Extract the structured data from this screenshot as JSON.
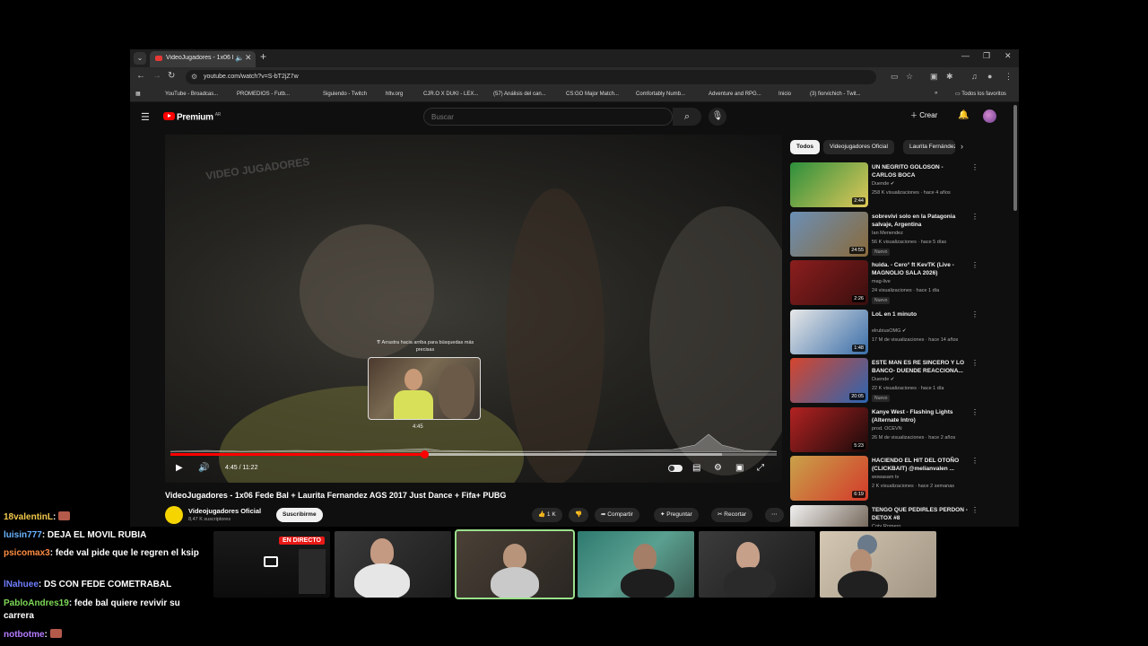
{
  "browser": {
    "tab_title": "VideoJugadores - 1x06 Fede",
    "url": "youtube.com/watch?v=S-bT2jZ7w",
    "bookmarks": [
      {
        "label": "YouTube - Broadcas...",
        "color": "#e53935"
      },
      {
        "label": "PROMEDIOS - Futb...",
        "color": "#43a047"
      },
      {
        "label": "",
        "color": "#000000"
      },
      {
        "label": "Siguiendo - Twitch",
        "color": "#9146ff"
      },
      {
        "label": "hltv.org",
        "color": "#2c5d9c"
      },
      {
        "label": "CJR.O X DUKI - LEX...",
        "color": "#e53935"
      },
      {
        "label": "(57) Análisis del can...",
        "color": "#9146ff"
      },
      {
        "label": "CS:GO Major Match...",
        "color": "#aaaaaa"
      },
      {
        "label": "Comfortably Numb...",
        "color": "#1e88e5"
      },
      {
        "label": "Adventure and RPG...",
        "color": "#e53935"
      },
      {
        "label": "Inicio",
        "color": "#000000"
      },
      {
        "label": "(3) fiorvichich - Twit...",
        "color": "#9146ff"
      }
    ],
    "all_favorites": "Todos los favoritos"
  },
  "youtube": {
    "brand": "Premium",
    "brand_sup": "AR",
    "search_placeholder": "Buscar",
    "create_label": "Crear",
    "player": {
      "watermark": "VIDEO JUGADORES",
      "hint": "⇈ Arrastra hacia arriba para búsquedas más precisas",
      "preview_time": "4:45",
      "time": "4:45 / 11:22",
      "progress": 0.42,
      "buffered": 0.91
    },
    "video_title": "VideoJugadores - 1x06 Fede Bal + Laurita Fernandez AGS 2017 Just Dance + Fifa+ PUBG",
    "channel_name": "Videojugadores Oficial",
    "channel_subs": "8,47 K suscriptores",
    "subscribe": "Suscribirme",
    "actions": {
      "likes": "1 K",
      "share": "Compartir",
      "ask": "Preguntar",
      "clip": "Recortar"
    },
    "chips": [
      "Todos",
      "Videojugadores Oficial",
      "Laurita Fernández"
    ],
    "recommendations": [
      {
        "title": "UN NEGRITO GOLOSON - CARLOS BOCA",
        "channel": "Duende ✔",
        "meta": "258 K visualizaciones · hace 4 años",
        "badge": "",
        "duration": "2:44",
        "colors": [
          "#2c8f3c",
          "#e0c85a"
        ]
      },
      {
        "title": "sobrevivi solo en la Patagonia salvaje, Argentina",
        "channel": "Ian Menendez",
        "meta": "56 K visualizaciones · hace 5 días",
        "badge": "Nuevo",
        "duration": "24:55",
        "colors": [
          "#6b8fb5",
          "#8a6a3a"
        ]
      },
      {
        "title": "huida. - Cero° ft KevTK (Live - MAGNOLIO SALA 2026)",
        "channel": "mag-live",
        "meta": "24 visualizaciones · hace 1 día",
        "badge": "Nuevo",
        "duration": "2:26",
        "colors": [
          "#8c1e1e",
          "#3a0e0e"
        ]
      },
      {
        "title": "LoL en 1 minuto",
        "channel": "elrubiusOMG ✔",
        "meta": "17 M de visualizaciones · hace 14 años",
        "badge": "",
        "duration": "1:48",
        "colors": [
          "#e8e8e8",
          "#3a6ea8"
        ]
      },
      {
        "title": "ESTE MAN ES RE SINCERO Y LO BANCO- DUENDE REACCIONA...",
        "channel": "Duende ✔",
        "meta": "22 K visualizaciones · hace 1 día",
        "badge": "Nuevo",
        "duration": "20:05",
        "colors": [
          "#d6452d",
          "#2b66b3"
        ]
      },
      {
        "title": "Kanye West - Flashing Lights (Alternate Intro)",
        "channel": "prod. OCEVN",
        "meta": "26 M de visualizaciones · hace 2 años",
        "badge": "",
        "duration": "5:23",
        "colors": [
          "#b32222",
          "#1a0a0a"
        ]
      },
      {
        "title": "HACIENDO EL HIT DEL OTOÑO (CLICKBAIT) @melianvalen ...",
        "channel": "wowasam tv",
        "meta": "2 K visualizaciones · hace 2 semanas",
        "badge": "",
        "duration": "6:19",
        "colors": [
          "#c9a24a",
          "#d33a2a"
        ]
      },
      {
        "title": "TENGO QUE PEDIRLES PERDON - DETOX #8",
        "channel": "Coty Romero",
        "meta": "",
        "badge": "",
        "duration": "",
        "colors": [
          "#f1f1f1",
          "#5a4a3a"
        ]
      }
    ]
  },
  "chat": [
    {
      "user": "18valentinL",
      "color": "#f2c94c",
      "text": "",
      "emote": true
    },
    {
      "user": "luisin777",
      "color": "#6ab4ff",
      "text": "DEJA EL MOVIL RUBIA",
      "emote": false
    },
    {
      "user": "psicomax3",
      "color": "#ff8c42",
      "text": "fede val pide que le regren el ksip",
      "emote": false
    },
    {
      "user": "lNahuee",
      "color": "#6f7fff",
      "text": "DS CON FEDE COMETRABAL",
      "emote": false
    },
    {
      "user": "PabloAndres19",
      "color": "#7ed957",
      "text": "fede bal quiere revivir su carrera",
      "emote": false
    },
    {
      "user": "notbotme",
      "color": "#b57bff",
      "text": "",
      "emote": true
    }
  ],
  "cams": {
    "live_label": "EN DIRECTO",
    "selected_index": 2
  }
}
